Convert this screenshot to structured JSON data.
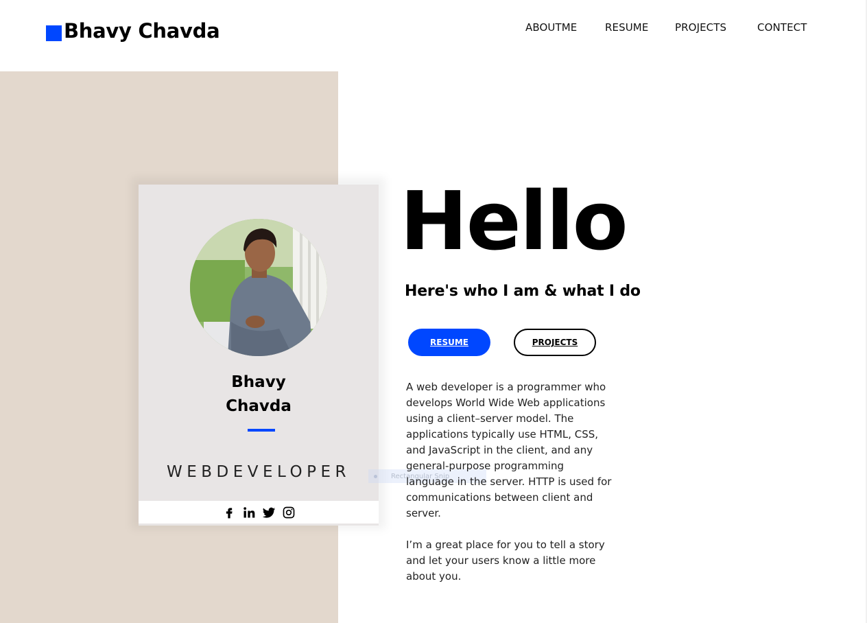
{
  "brand": {
    "name": "Bhavy Chavda",
    "accent_color": "#0047ff"
  },
  "nav": {
    "items": [
      {
        "label": "ABOUTME"
      },
      {
        "label": "RESUME"
      },
      {
        "label": "PROJECTS"
      },
      {
        "label": "CONTECT"
      }
    ]
  },
  "profile_card": {
    "first_name": "Bhavy",
    "last_name": "Chavda",
    "role": "WEBDEVELOPER",
    "social": [
      "facebook-icon",
      "linkedin-icon",
      "twitter-icon",
      "instagram-icon"
    ]
  },
  "ghost_tooltip": {
    "label": "Rectangular Snip"
  },
  "hero": {
    "greeting": "Hello",
    "subtitle": "Here's who I am & what I do",
    "resume_button": "RESUME",
    "projects_button": "PROJECTS",
    "bio_paragraph_1": "A web developer is a programmer who develops World Wide Web applications using a client–server model. The applications typically use HTML, CSS, and JavaScript in the client, and any general-purpose programming language in the server. HTTP is used for communications between client and server.",
    "bio_paragraph_2": "I’m a great place for you to tell a story and let your users know a little more about you."
  },
  "colors": {
    "beige_panel": "#e3d8cd",
    "card_background": "#e8e5e5",
    "primary_button": "#0047ff"
  }
}
